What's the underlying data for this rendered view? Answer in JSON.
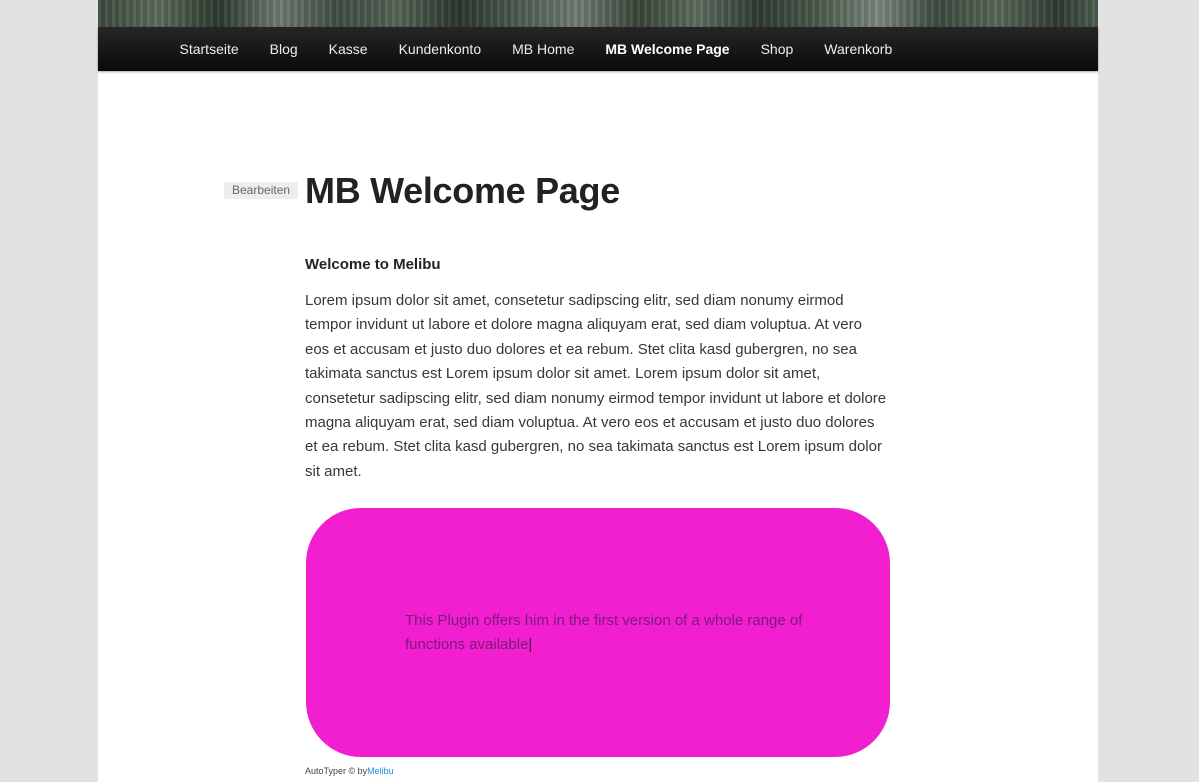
{
  "nav": {
    "items": [
      {
        "label": "Startseite",
        "current": false
      },
      {
        "label": "Blog",
        "current": false
      },
      {
        "label": "Kasse",
        "current": false
      },
      {
        "label": "Kundenkonto",
        "current": false
      },
      {
        "label": "MB Home",
        "current": false
      },
      {
        "label": "MB Welcome Page",
        "current": true
      },
      {
        "label": "Shop",
        "current": false
      },
      {
        "label": "Warenkorb",
        "current": false
      }
    ]
  },
  "content": {
    "edit_label": "Bearbeiten",
    "title": "MB Welcome Page",
    "subtitle": "Welcome to Melibu",
    "paragraph": "Lorem ipsum dolor sit amet, consetetur sadipscing elitr, sed diam nonumy eirmod tempor invidunt ut labore et dolore magna aliquyam erat, sed diam voluptua. At vero eos et accusam et justo duo dolores et ea rebum. Stet clita kasd gubergren, no sea takimata sanctus est Lorem ipsum dolor sit amet. Lorem ipsum dolor sit amet, consetetur sadipscing elitr, sed diam nonumy eirmod tempor invidunt ut labore et dolore magna aliquyam erat, sed diam voluptua. At vero eos et accusam et justo duo dolores et ea rebum. Stet clita kasd gubergren, no sea takimata sanctus est Lorem ipsum dolor sit amet."
  },
  "autotyper": {
    "text": "This Plugin offers him in the first version of a whole range of functions available",
    "caret": "|",
    "box_color": "#f21fd1",
    "credit_prefix": "AutoTyper © by",
    "credit_link": "Melibu"
  }
}
